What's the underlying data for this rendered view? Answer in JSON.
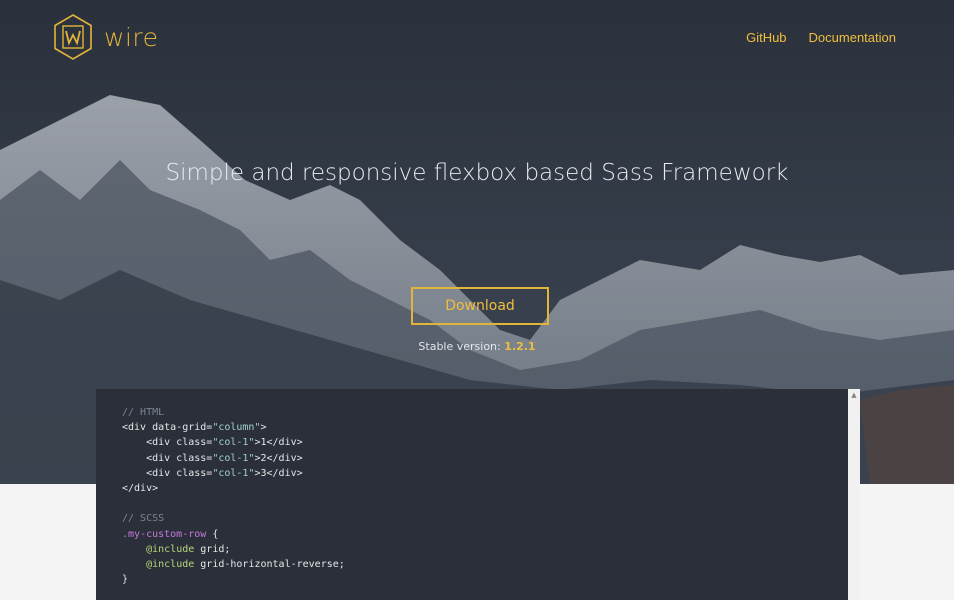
{
  "brand": {
    "name": "wire",
    "logo_letter": "W"
  },
  "nav": {
    "items": [
      "GitHub",
      "Documentation"
    ]
  },
  "hero": {
    "tagline": "Simple and responsive flexbox based Sass Framework",
    "download_label": "Download",
    "stable_label": "Stable version:",
    "stable_version": "1.2.1"
  },
  "code": {
    "lines": [
      [
        {
          "t": "// HTML",
          "c": "comment"
        }
      ],
      [
        {
          "t": "<div data-grid="
        },
        {
          "t": "\"column\"",
          "c": "str"
        },
        {
          "t": ">"
        }
      ],
      [
        {
          "t": "    <div class="
        },
        {
          "t": "\"col-1\"",
          "c": "str"
        },
        {
          "t": ">1</div>"
        }
      ],
      [
        {
          "t": "    <div class="
        },
        {
          "t": "\"col-1\"",
          "c": "str"
        },
        {
          "t": ">2</div>"
        }
      ],
      [
        {
          "t": "    <div class="
        },
        {
          "t": "\"col-1\"",
          "c": "str"
        },
        {
          "t": ">3</div>"
        }
      ],
      [
        {
          "t": "</div>"
        }
      ],
      [],
      [
        {
          "t": "// SCSS",
          "c": "comment"
        }
      ],
      [
        {
          "t": ".my-custom-row",
          "c": "sel"
        },
        {
          "t": " {"
        }
      ],
      [
        {
          "t": "    "
        },
        {
          "t": "@include",
          "c": "kw"
        },
        {
          "t": " grid;"
        }
      ],
      [
        {
          "t": "    "
        },
        {
          "t": "@include",
          "c": "kw"
        },
        {
          "t": " grid-horizontal-reverse;"
        }
      ],
      [
        {
          "t": "}"
        }
      ]
    ]
  },
  "colors": {
    "accent": "#f0be3c",
    "code_bg": "#2b2f3a",
    "page_bg": "#f4f4f4"
  },
  "icons": {
    "logo": "hexagon-w-logo-icon",
    "scroll_up": "scroll-up-arrow-icon"
  }
}
